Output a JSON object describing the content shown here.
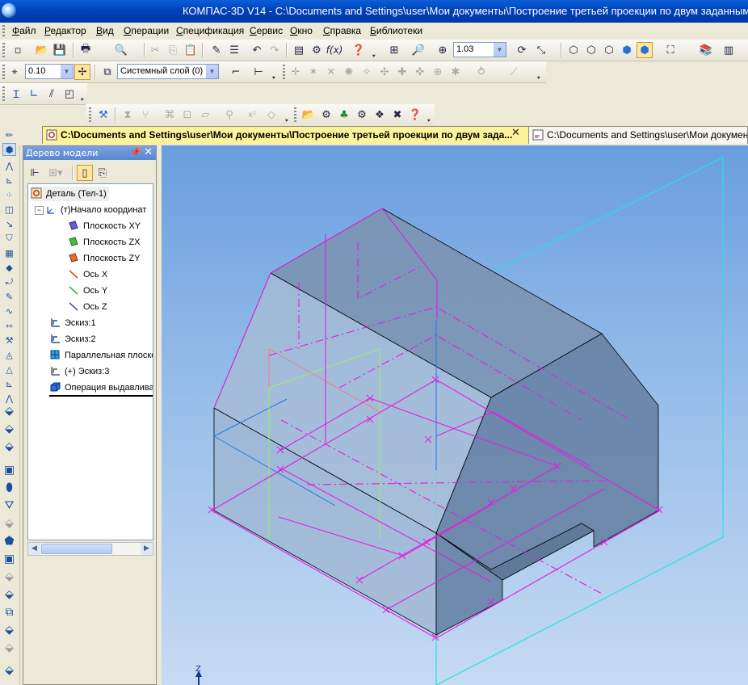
{
  "window": {
    "title": "КОМПАС-3D V14 - C:\\Documents and Settings\\user\\Мои документы\\Построение третьей проекции по двум заданным\\"
  },
  "menu": {
    "items": [
      "Файл",
      "Редактор",
      "Вид",
      "Операции",
      "Спецификация",
      "Сервис",
      "Окно",
      "Справка",
      "Библиотеки"
    ]
  },
  "toolbar": {
    "zoom_value": "1.03",
    "step_value": "0.10",
    "layer_value": "Системный слой (0)"
  },
  "tabs": [
    {
      "label": "C:\\Documents and Settings\\user\\Мои документы\\Построение третьей проекции по двум зада..."
    },
    {
      "label": "C:\\Documents and Settings\\user\\Мои документы\\Пост"
    }
  ],
  "panel": {
    "title": "Дерево модели",
    "tree": [
      {
        "label": "Деталь (Тел-1)",
        "icon": "part-icon"
      },
      {
        "label": "(т)Начало координат",
        "icon": "origin-icon"
      },
      {
        "label": "Плоскость XY",
        "icon": "plane-xy-icon"
      },
      {
        "label": "Плоскость ZX",
        "icon": "plane-zx-icon"
      },
      {
        "label": "Плоскость ZY",
        "icon": "plane-zy-icon"
      },
      {
        "label": "Ось X",
        "icon": "axis-x-icon"
      },
      {
        "label": "Ось Y",
        "icon": "axis-y-icon"
      },
      {
        "label": "Ось Z",
        "icon": "axis-z-icon"
      },
      {
        "label": "Эскиз:1",
        "icon": "sketch-icon"
      },
      {
        "label": "Эскиз:2",
        "icon": "sketch-icon"
      },
      {
        "label": "Параллельная плоскость",
        "icon": "parallel-plane-icon"
      },
      {
        "label": "(+) Эскиз:3",
        "icon": "sketch-icon"
      },
      {
        "label": "Операция выдавливания",
        "icon": "extrude-icon"
      }
    ]
  },
  "viewport": {
    "axis_label": "Z"
  },
  "colors": {
    "title_bg": "#0a5fd8",
    "active_tab_bg": "#fef29a",
    "viewport_top": "#6a9ede",
    "model_fill": "#8fa9c7",
    "sketch_magenta": "#e020e0",
    "plane_cyan": "#23e1e8"
  }
}
